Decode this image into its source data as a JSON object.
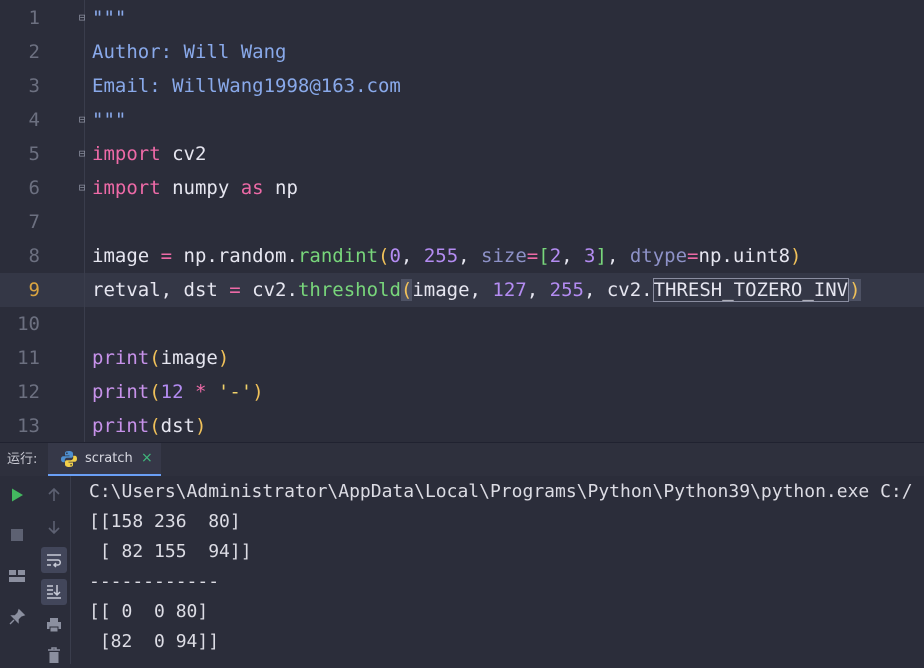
{
  "editor": {
    "current_line": 9,
    "line_numbers": [
      "1",
      "2",
      "3",
      "4",
      "5",
      "6",
      "7",
      "8",
      "9",
      "10",
      "11",
      "12",
      "13"
    ],
    "lines": [
      [
        {
          "t": "\"\"\"",
          "c": "c-doc"
        }
      ],
      [
        {
          "t": "Author: Will Wang",
          "c": "c-doc"
        }
      ],
      [
        {
          "t": "Email: WillWang1998@163.com",
          "c": "c-doc"
        }
      ],
      [
        {
          "t": "\"\"\"",
          "c": "c-doc"
        }
      ],
      [
        {
          "t": "import",
          "c": "c-kw"
        },
        {
          "t": " cv2",
          "c": "c-id"
        }
      ],
      [
        {
          "t": "import",
          "c": "c-kw"
        },
        {
          "t": " numpy ",
          "c": "c-id"
        },
        {
          "t": "as",
          "c": "c-kw"
        },
        {
          "t": " np",
          "c": "c-id"
        }
      ],
      [],
      [
        {
          "t": "image ",
          "c": "c-id"
        },
        {
          "t": "=",
          "c": "c-op"
        },
        {
          "t": " np.random.",
          "c": "c-id"
        },
        {
          "t": "randint",
          "c": "c-fn"
        },
        {
          "t": "(",
          "c": "c-pu"
        },
        {
          "t": "0",
          "c": "c-num"
        },
        {
          "t": ", ",
          "c": "c-id"
        },
        {
          "t": "255",
          "c": "c-num"
        },
        {
          "t": ", ",
          "c": "c-id"
        },
        {
          "t": "size",
          "c": "c-param"
        },
        {
          "t": "=",
          "c": "c-op"
        },
        {
          "t": "[",
          "c": "c-fn"
        },
        {
          "t": "2",
          "c": "c-num"
        },
        {
          "t": ", ",
          "c": "c-id"
        },
        {
          "t": "3",
          "c": "c-num"
        },
        {
          "t": "]",
          "c": "c-fn"
        },
        {
          "t": ", ",
          "c": "c-id"
        },
        {
          "t": "dtype",
          "c": "c-param"
        },
        {
          "t": "=",
          "c": "c-op"
        },
        {
          "t": "np.uint8",
          "c": "c-id"
        },
        {
          "t": ")",
          "c": "c-pu"
        }
      ],
      [
        {
          "t": "retval, dst ",
          "c": "c-id"
        },
        {
          "t": "=",
          "c": "c-op"
        },
        {
          "t": " cv2.",
          "c": "c-id"
        },
        {
          "t": "threshold",
          "c": "c-fn"
        },
        {
          "t": "(",
          "c": "c-pu pbox"
        },
        {
          "t": "image, ",
          "c": "c-id"
        },
        {
          "t": "127",
          "c": "c-num"
        },
        {
          "t": ", ",
          "c": "c-id"
        },
        {
          "t": "255",
          "c": "c-num"
        },
        {
          "t": ", cv2.",
          "c": "c-id"
        },
        {
          "t": "THRESH_TOZERO_INV",
          "c": "c-id box"
        },
        {
          "t": ")",
          "c": "c-pu pbox"
        }
      ],
      [],
      [
        {
          "t": "print",
          "c": "c-bi"
        },
        {
          "t": "(",
          "c": "c-pu"
        },
        {
          "t": "image",
          "c": "c-id"
        },
        {
          "t": ")",
          "c": "c-pu"
        }
      ],
      [
        {
          "t": "print",
          "c": "c-bi"
        },
        {
          "t": "(",
          "c": "c-pu"
        },
        {
          "t": "12",
          "c": "c-num"
        },
        {
          "t": " ",
          "c": "c-id"
        },
        {
          "t": "*",
          "c": "c-op"
        },
        {
          "t": " ",
          "c": "c-id"
        },
        {
          "t": "'-'",
          "c": "c-str"
        },
        {
          "t": ")",
          "c": "c-pu"
        }
      ],
      [
        {
          "t": "print",
          "c": "c-bi"
        },
        {
          "t": "(",
          "c": "c-pu"
        },
        {
          "t": "dst",
          "c": "c-id"
        },
        {
          "t": ")",
          "c": "c-pu"
        }
      ]
    ]
  },
  "run_panel": {
    "label": "运行:",
    "tab_label": "scratch",
    "tab_icon": "python-icon",
    "toolbar_icons": [
      "run-icon",
      "up-arrow-icon",
      "stop-icon",
      "down-arrow-icon",
      "layout-icon",
      "soft-wrap-icon",
      "scroll-to-end-icon",
      "pin-icon",
      "print-icon",
      "trash-icon"
    ],
    "console_lines": [
      "C:\\Users\\Administrator\\AppData\\Local\\Programs\\Python\\Python39\\python.exe C:/",
      "[[158 236  80]",
      " [ 82 155  94]]",
      "------------",
      "[[ 0  0 80]",
      " [82  0 94]]"
    ]
  }
}
